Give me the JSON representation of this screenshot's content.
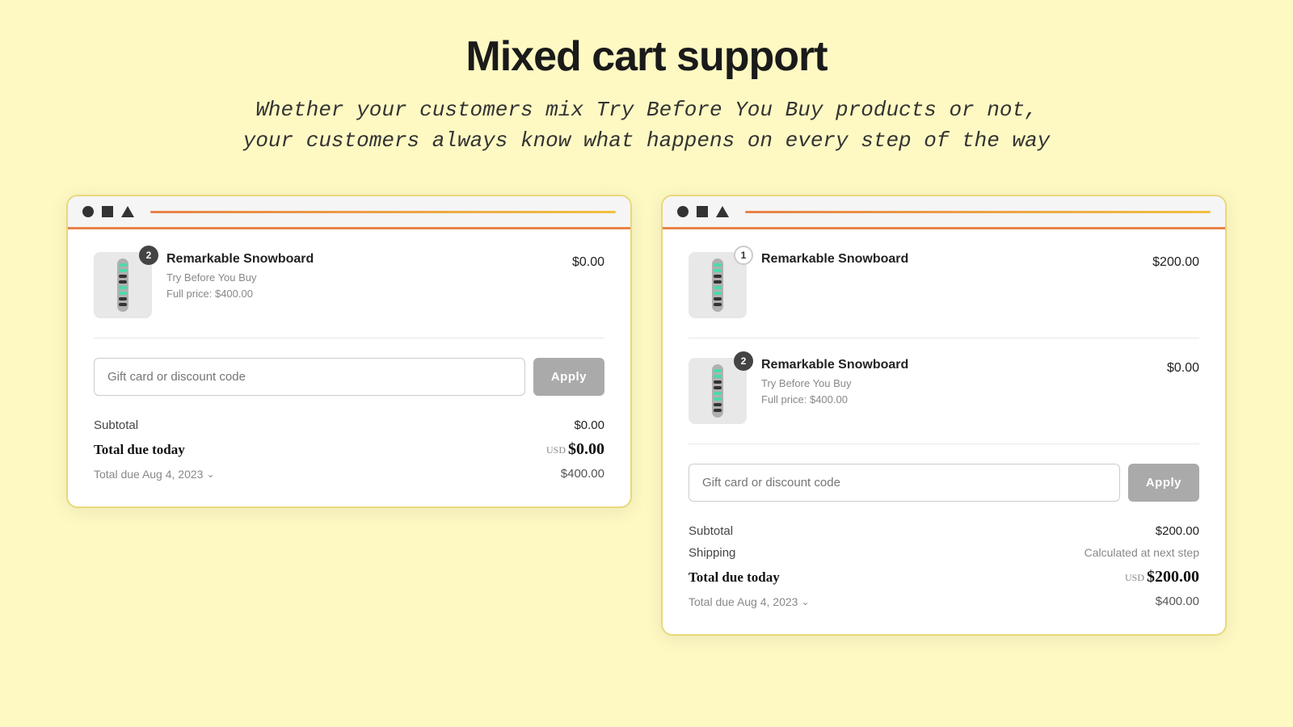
{
  "page": {
    "title": "Mixed cart support",
    "subtitle_line1": "Whether your customers mix Try Before You Buy products or not,",
    "subtitle_line2": "your customers always know what happens on every step of the way"
  },
  "card_left": {
    "product": {
      "name": "Remarkable Snowboard",
      "sub1": "Try Before You Buy",
      "sub2": "Full price: $400.00",
      "price": "$0.00",
      "qty": "2"
    },
    "discount": {
      "placeholder": "Gift card or discount code",
      "apply_label": "Apply"
    },
    "subtotal_label": "Subtotal",
    "subtotal_value": "$0.00",
    "total_due_label": "Total due today",
    "total_due_usd": "USD",
    "total_due_value": "$0.00",
    "aug_label": "Total due Aug 4, 2023",
    "aug_value": "$400.00"
  },
  "card_right": {
    "product1": {
      "name": "Remarkable Snowboard",
      "price": "$200.00",
      "qty": "1"
    },
    "product2": {
      "name": "Remarkable Snowboard",
      "sub1": "Try Before You Buy",
      "sub2": "Full price: $400.00",
      "price": "$0.00",
      "qty": "2"
    },
    "discount": {
      "placeholder": "Gift card or discount code",
      "apply_label": "Apply"
    },
    "subtotal_label": "Subtotal",
    "subtotal_value": "$200.00",
    "shipping_label": "Shipping",
    "shipping_value": "Calculated at next step",
    "total_due_label": "Total due today",
    "total_due_usd": "USD",
    "total_due_value": "$200.00",
    "aug_label": "Total due Aug 4, 2023",
    "aug_value": "$400.00"
  }
}
